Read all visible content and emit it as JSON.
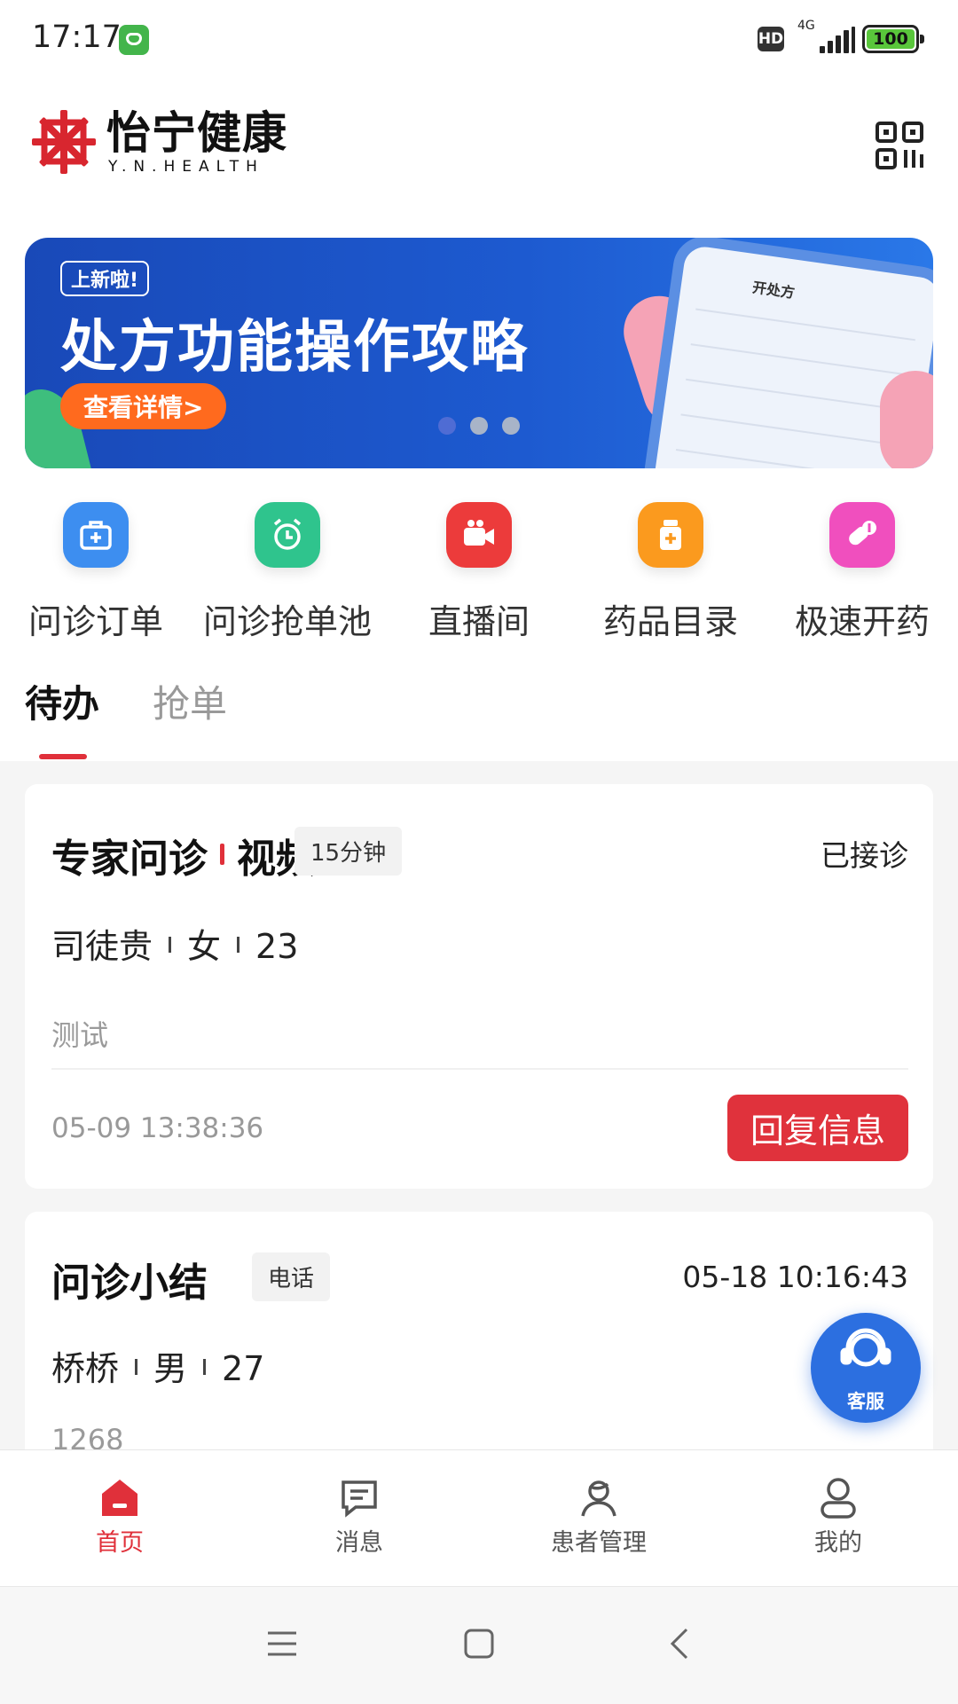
{
  "status_bar": {
    "time": "17:17",
    "network": "4G",
    "hd_label": "HD",
    "battery": "100",
    "battery_level": 1.0
  },
  "header": {
    "brand_name": "怡宁健康",
    "brand_sub": "Y.N.HEALTH"
  },
  "banner": {
    "tag": "上新啦!",
    "title": "处方功能操作攻略",
    "button": "查看详情>",
    "phone_title": "开处方",
    "active_slide": 1,
    "slide_count": 3
  },
  "quick_actions": [
    {
      "label": "问诊订单",
      "icon": "medical-kit-icon",
      "color": "#3d8ef0"
    },
    {
      "label": "问诊抢单池",
      "icon": "alarm-clock-icon",
      "color": "#2fc48d"
    },
    {
      "label": "直播间",
      "icon": "video-camera-icon",
      "color": "#ec3b3b"
    },
    {
      "label": "药品目录",
      "icon": "medicine-bottle-icon",
      "color": "#fb9a1e"
    },
    {
      "label": "极速开药",
      "icon": "pills-icon",
      "color": "#f04fbe"
    }
  ],
  "tabs": [
    {
      "label": "待办",
      "active": true
    },
    {
      "label": "抢单",
      "active": false
    }
  ],
  "cards": [
    {
      "title_a": "专家问诊",
      "title_b": "视频",
      "tag": "15分钟",
      "status": "已接诊",
      "patient_name": "司徒贵",
      "gender": "女",
      "age": "23",
      "note": "测试",
      "time": "05-09 13:38:36",
      "button": "回复信息"
    },
    {
      "title": "问诊小结",
      "tag": "电话",
      "time": "05-18 10:16:43",
      "patient_name": "桥桥",
      "gender": "男",
      "age": "27",
      "note": "1268"
    }
  ],
  "fab": {
    "label": "客服"
  },
  "bottom_nav": [
    {
      "label": "首页",
      "icon": "home-icon",
      "active": true
    },
    {
      "label": "消息",
      "icon": "message-icon",
      "active": false
    },
    {
      "label": "患者管理",
      "icon": "patient-icon",
      "active": false
    },
    {
      "label": "我的",
      "icon": "profile-icon",
      "active": false
    }
  ],
  "colors": {
    "accent": "#e0303a",
    "banner_blue": "#1d5ad0",
    "fab_blue": "#2c6fe0"
  }
}
